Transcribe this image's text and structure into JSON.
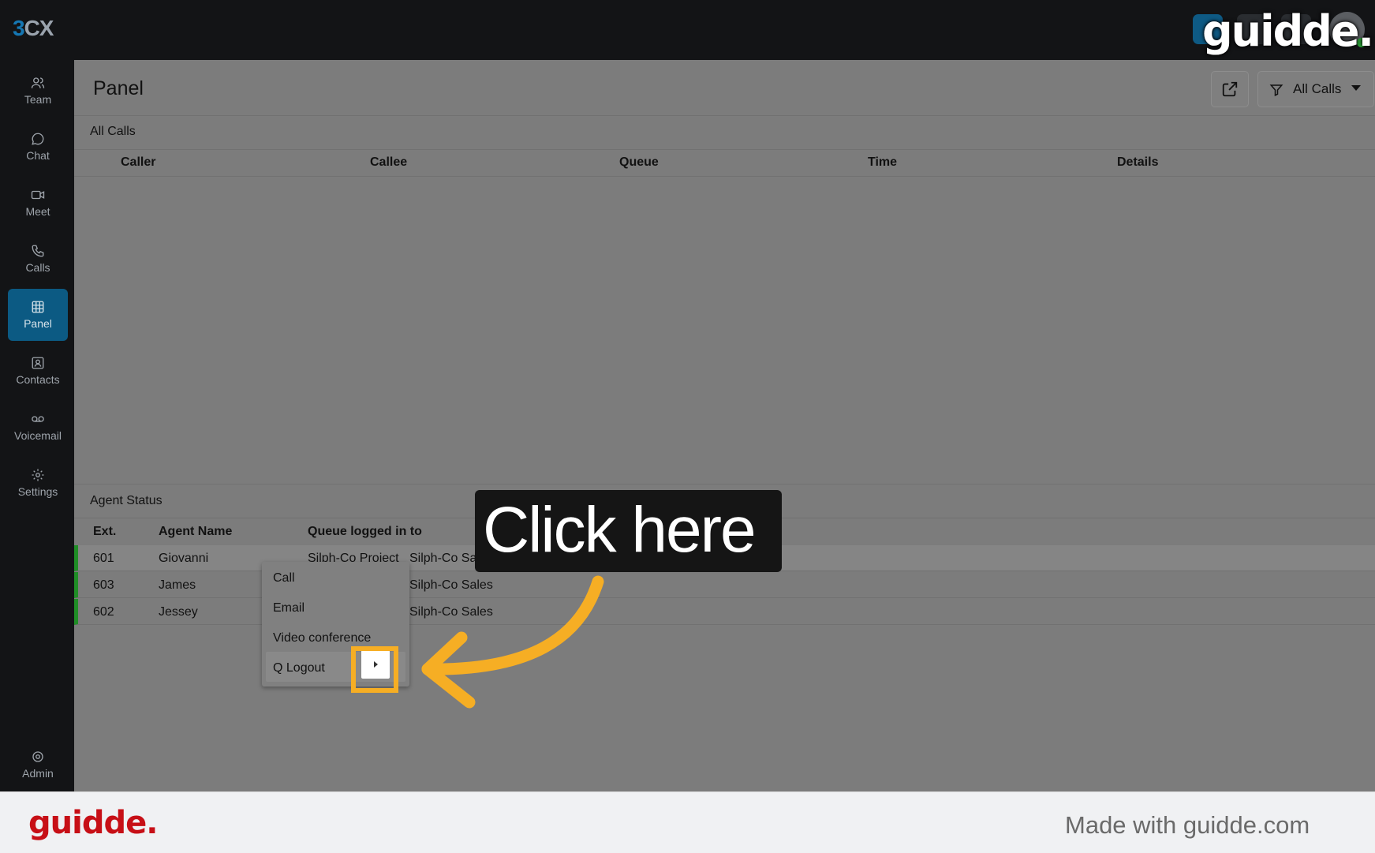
{
  "header": {
    "logo_digit": "3",
    "logo_letters": "CX",
    "watermark": "guidde."
  },
  "sidebar": {
    "items": [
      {
        "label": "Team",
        "icon": "users-icon"
      },
      {
        "label": "Chat",
        "icon": "chat-bubble-icon"
      },
      {
        "label": "Meet",
        "icon": "video-icon"
      },
      {
        "label": "Calls",
        "icon": "phone-icon"
      },
      {
        "label": "Panel",
        "icon": "grid-icon",
        "active": true
      },
      {
        "label": "Contacts",
        "icon": "contact-card-icon"
      },
      {
        "label": "Voicemail",
        "icon": "voicemail-icon"
      },
      {
        "label": "Settings",
        "icon": "gear-icon"
      }
    ],
    "bottom": {
      "label": "Admin",
      "icon": "admin-gear-icon"
    }
  },
  "panel": {
    "title": "Panel",
    "filter_label": "All Calls",
    "calls_section": {
      "label": "All Calls",
      "columns": [
        "Caller",
        "Callee",
        "Queue",
        "Time",
        "Details"
      ]
    },
    "agent_section": {
      "label": "Agent Status",
      "columns": [
        "Ext.",
        "Agent Name",
        "Queue logged in to"
      ],
      "rows": [
        {
          "ext": "601",
          "name": "Giovanni",
          "queue_a": "Silph-Co Project",
          "queue_b": "Silph-Co Sales"
        },
        {
          "ext": "603",
          "name": "James",
          "queue_b": "Silph-Co Sales"
        },
        {
          "ext": "602",
          "name": "Jessey",
          "queue_b": "Silph-Co Sales"
        }
      ]
    }
  },
  "context_menu": {
    "items": [
      "Call",
      "Email",
      "Video conference",
      "Q Logout"
    ]
  },
  "callout": {
    "text": "Click here"
  },
  "footer": {
    "logo": "guidde.",
    "made_with": "Made with guidde.com"
  },
  "colors": {
    "accent_blue": "#0c5a83",
    "highlight_orange": "#f6ae24",
    "status_green": "#1f8d26",
    "guidde_red": "#c70f16"
  }
}
